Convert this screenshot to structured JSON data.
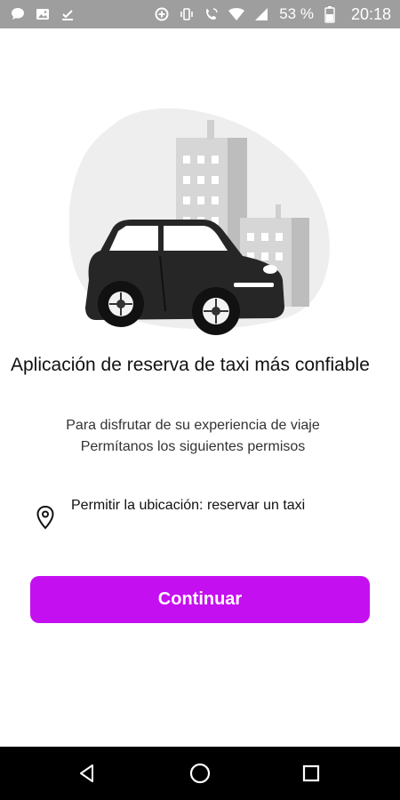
{
  "status_bar": {
    "battery_percent": "53 %",
    "time": "20:18",
    "left_icons": [
      "chat-bubble-icon",
      "image-icon",
      "download-check-icon"
    ],
    "right_icons": [
      "data-saver-icon",
      "vibrate-icon",
      "wifi-calling-icon",
      "wifi-icon",
      "signal-icon",
      "battery-icon"
    ]
  },
  "main": {
    "illustration_icon": "taxi-car-city-illustration",
    "title": "Aplicación de reserva de taxi más confiable",
    "subtitle_lines": [
      "Para disfrutar de su experiencia de viaje",
      "Permítanos los siguientes permisos"
    ],
    "permission": {
      "icon": "location-pin-icon",
      "text": "Permitir la ubicación: reservar un taxi"
    },
    "continue_label": "Continuar"
  },
  "nav_bar": {
    "icons": [
      "back-icon",
      "home-icon",
      "recents-icon"
    ]
  },
  "colors": {
    "accent": "#c40ff0",
    "status_bar": "#9e9e9e",
    "nav_bar": "#000000"
  }
}
